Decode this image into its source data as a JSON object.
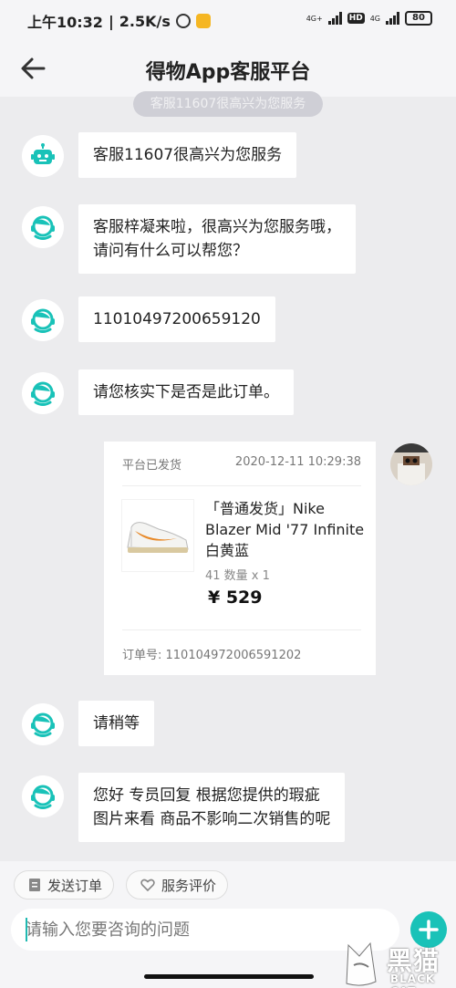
{
  "status_bar": {
    "time": "上午10:32",
    "speed": "2.5K/s",
    "network1": "4G+",
    "hd": "HD",
    "network2": "4G",
    "battery": "80"
  },
  "header": {
    "title": "得物App客服平台"
  },
  "previous_pill": "客服11607很高兴为您服务",
  "messages": [
    {
      "lines": [
        "客服11607很高兴为您服务"
      ],
      "avatar": "robot-icon"
    },
    {
      "lines": [
        "客服梓凝来啦，很高兴为您服务哦，",
        "请问有什么可以帮您？"
      ],
      "avatar": "agent-icon"
    },
    {
      "lines": [
        "11010497200659120"
      ],
      "avatar": "agent-icon"
    },
    {
      "lines": [
        "请您核实下是否是此订单。"
      ],
      "avatar": "agent-icon"
    },
    {
      "lines": [
        "请稍等"
      ],
      "avatar": "agent-icon"
    },
    {
      "lines": [
        "您好  专员回复  根据您提供的瑕疵",
        "图片来看  商品不影响二次销售的呢"
      ],
      "avatar": "agent-icon"
    }
  ],
  "order_card": {
    "status": "平台已发货",
    "time": "2020-12-11 10:29:38",
    "product_name": "「普通发货」Nike Blazer Mid '77 Infinite 白黄蓝",
    "size_qty": "41  数量 x 1",
    "price": "¥ 529",
    "order_no": "订单号: 110104972006591202"
  },
  "bottom": {
    "send_order": "发送订单",
    "rate_service": "服务评价",
    "input_placeholder": "请输入您要咨询的问题"
  },
  "watermark": {
    "cn": "黑猫",
    "en": "BLACK CAT"
  },
  "colors": {
    "accent": "#19c2b8",
    "background": "#ececee"
  }
}
